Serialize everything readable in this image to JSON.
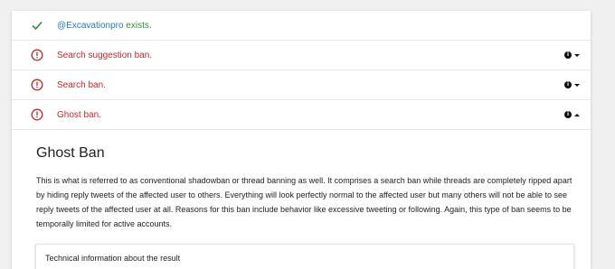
{
  "results": [
    {
      "status_icon": "check-icon",
      "parts": [
        "@Excavationpro",
        " exists."
      ]
    },
    {
      "status_icon": "alert-circle-icon",
      "label": "Search suggestion ban.",
      "expanded": false
    },
    {
      "status_icon": "alert-circle-icon",
      "label": "Search ban.",
      "expanded": false
    },
    {
      "status_icon": "alert-circle-icon",
      "label": "Ghost ban.",
      "expanded": true
    }
  ],
  "detail": {
    "title": "Ghost Ban",
    "description": "This is what is referred to as conventional shadowban or thread banning as well. It comprises a search ban while threads are completely ripped apart by hiding reply tweets of the affected user to others. Everything will look perfectly normal to the affected user but many others will not be able to see reply tweets of the affected user at all. Reasons for this ban include behavior like excessive tweeting or following. Again, this type of ban seems to be temporally limited for active accounts.",
    "technical_label": "Technical information about the result"
  },
  "info_glyph": "i",
  "colors": {
    "ok": "#2e8b3e",
    "user": "#1e7bc4",
    "error": "#c62828"
  }
}
